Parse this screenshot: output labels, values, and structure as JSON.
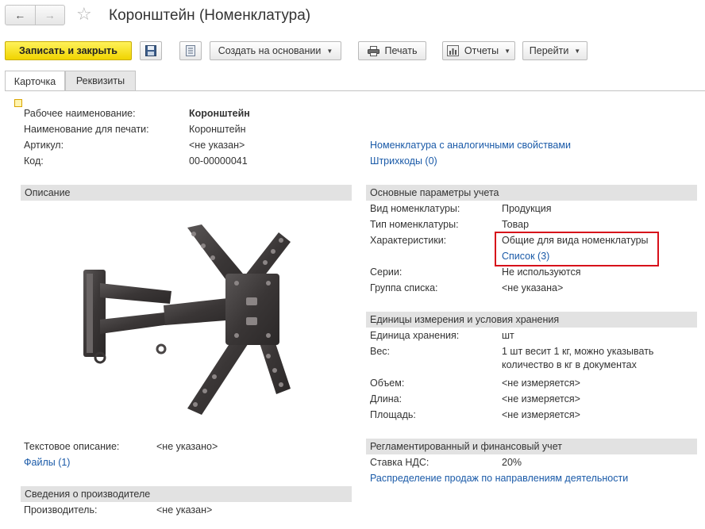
{
  "header": {
    "title": "Коронштейн (Номенклатура)",
    "back_icon": "arrow-left-icon",
    "forward_icon": "arrow-right-icon",
    "favorite_icon": "star-icon"
  },
  "toolbar": {
    "save_close": "Записать и закрыть",
    "create_based": "Создать на основании",
    "print": "Печать",
    "reports": "Отчеты",
    "goto": "Перейти",
    "accent": "#f5db0a"
  },
  "tabs": [
    {
      "label": "Карточка"
    },
    {
      "label": "Реквизиты"
    }
  ],
  "general": {
    "work_name_label": "Рабочее наименование:",
    "work_name_value": "Коронштейн",
    "print_name_label": "Наименование для печати:",
    "print_name_value": "Коронштейн",
    "article_label": "Артикул:",
    "article_value": "<не указан>",
    "code_label": "Код:",
    "code_value": "00-00000041",
    "similar_link": "Номенклатура с аналогичными свойствами",
    "barcodes_link": "Штрихкоды (0)"
  },
  "description": {
    "header": "Описание",
    "text_label": "Текстовое описание:",
    "text_value": "<не указано>",
    "files_link": "Файлы (1)"
  },
  "manufacturer": {
    "header": "Сведения о производителе",
    "label": "Производитель:",
    "value": "<не указан>"
  },
  "accounting": {
    "header": "Основные параметры учета",
    "kind_label": "Вид номенклатуры:",
    "kind_value": "Продукция",
    "type_label": "Тип номенклатуры:",
    "type_value": "Товар",
    "chars_label": "Характеристики:",
    "chars_value": "Общие для вида номенклатуры",
    "chars_link": "Список (3)",
    "series_label": "Серии:",
    "series_value": "Не используются",
    "group_label": "Группа списка:",
    "group_value": "<не указана>"
  },
  "units": {
    "header": "Единицы измерения и условия хранения",
    "storage_label": "Единица хранения:",
    "storage_value": "шт",
    "weight_label": "Вес:",
    "weight_value_1": "1 шт весит 1 кг, можно указывать",
    "weight_value_2": "количество в кг в документах",
    "volume_label": "Объем:",
    "volume_value": "<не измеряется>",
    "length_label": "Длина:",
    "length_value": "<не измеряется>",
    "area_label": "Площадь:",
    "area_value": "<не измеряется>"
  },
  "regulated": {
    "header": "Регламентированный и финансовый учет",
    "vat_label": "Ставка НДС:",
    "vat_value": "20%",
    "distribution_link": "Распределение продаж по направлениям деятельности"
  }
}
